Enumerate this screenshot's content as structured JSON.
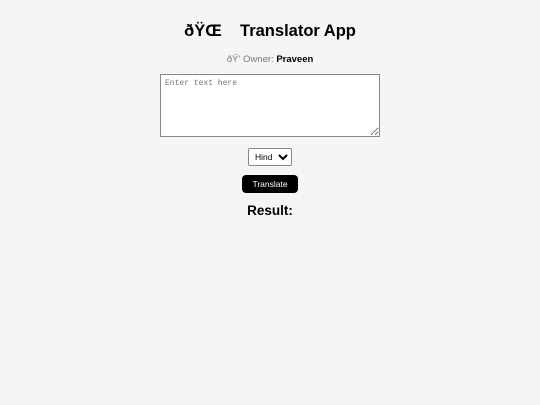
{
  "header": {
    "title": "ðŸŒ    Translator App"
  },
  "owner": {
    "prefix": "ðŸ‘ Owner: ",
    "name": "Praveen"
  },
  "input": {
    "value": "",
    "placeholder": "Enter text here"
  },
  "language_select": {
    "selected": "Hindi"
  },
  "translate_button": {
    "label": "Translate"
  },
  "result": {
    "heading": "Result:"
  }
}
